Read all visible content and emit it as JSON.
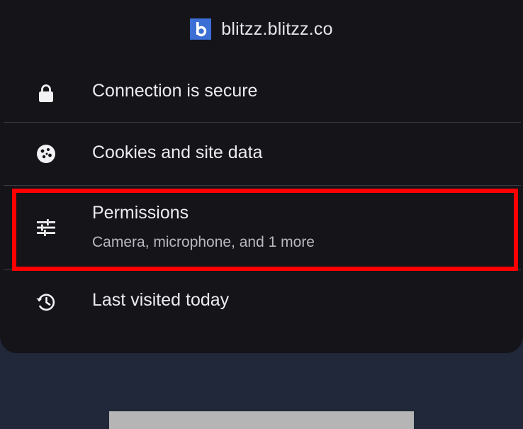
{
  "header": {
    "domain": "blitzz.blitzz.co",
    "favicon_icon": "blitzz-b-icon",
    "favicon_color": "#3b6fd6"
  },
  "rows": {
    "connection": {
      "label": "Connection is secure",
      "icon": "lock-icon"
    },
    "cookies": {
      "label": "Cookies and site data",
      "icon": "cookie-icon"
    },
    "permissions": {
      "label": "Permissions",
      "sublabel": "Camera, microphone, and 1 more",
      "icon": "tune-sliders-icon"
    },
    "history": {
      "label": "Last visited today",
      "icon": "history-icon"
    }
  },
  "colors": {
    "sheet_background": "#141419",
    "page_background": "#212839",
    "highlight": "#ff0000"
  }
}
